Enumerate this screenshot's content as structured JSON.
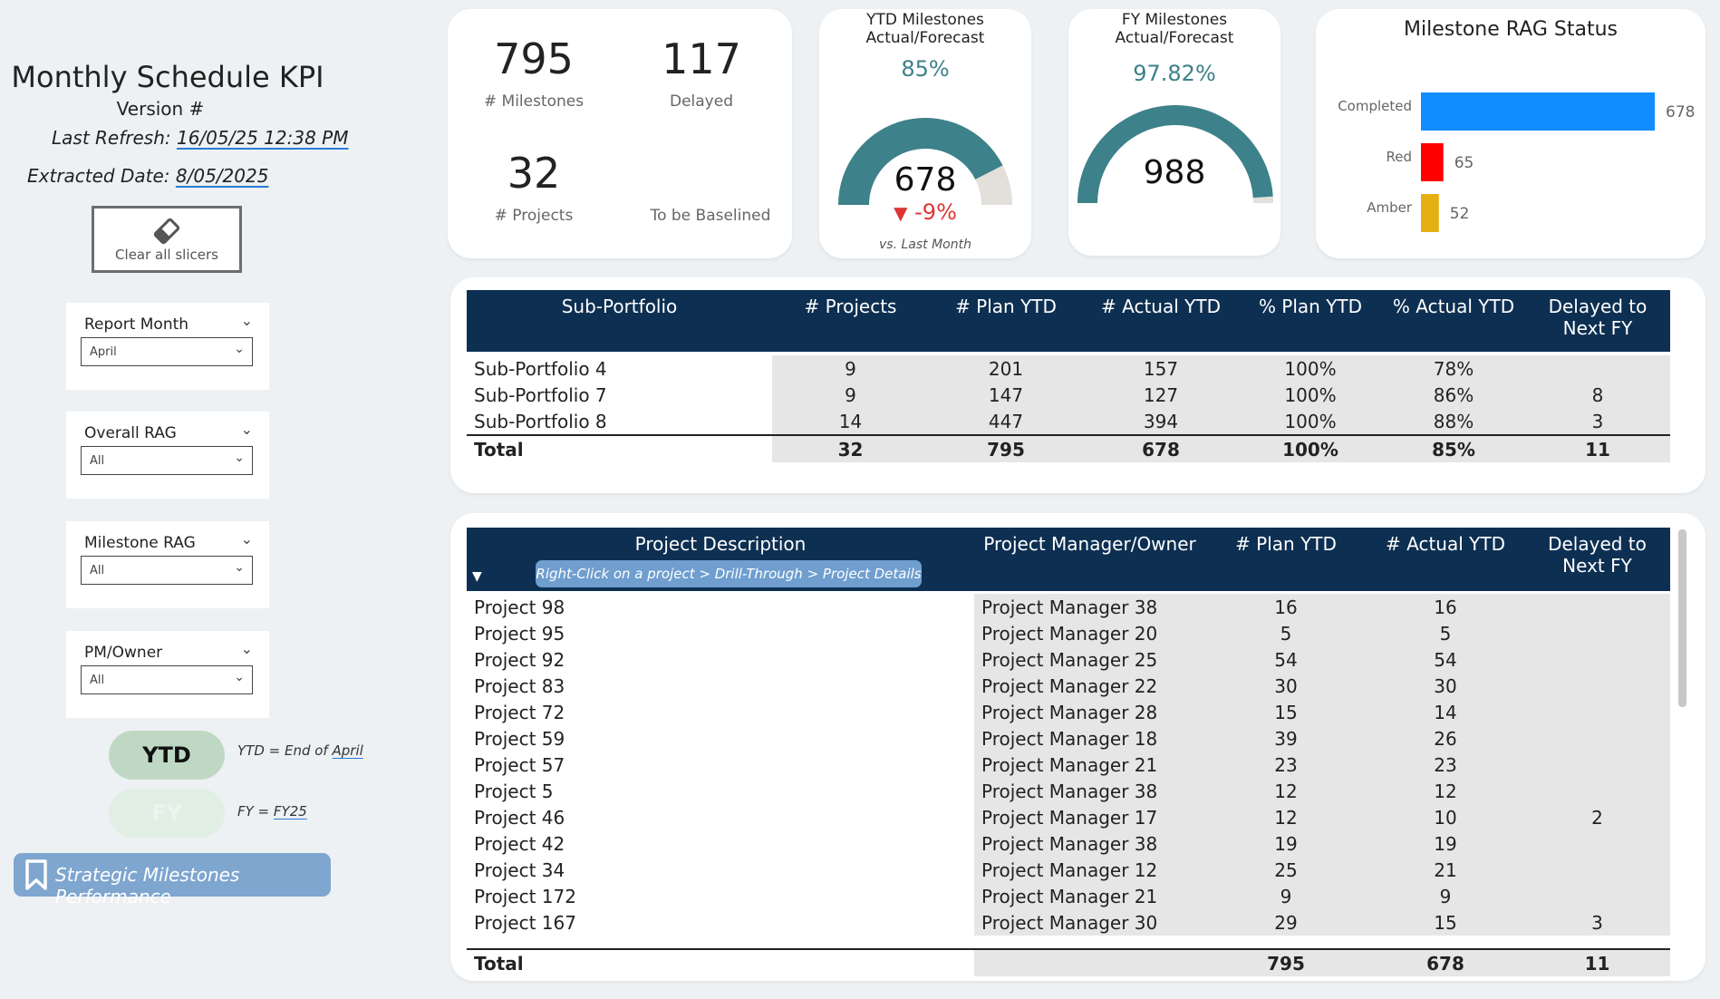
{
  "header": {
    "title": "Monthly Schedule KPI",
    "version": "Version #",
    "last_refresh_label": "Last Refresh:",
    "last_refresh_value": "16/05/25 12:38 PM",
    "extracted_label": "Extracted Date:",
    "extracted_value": "8/05/2025"
  },
  "clear_slicers": {
    "label": "Clear all slicers",
    "icon": "eraser-icon"
  },
  "slicers": [
    {
      "label": "Report Month",
      "value": "April"
    },
    {
      "label": "Overall RAG",
      "value": "All"
    },
    {
      "label": "Milestone RAG",
      "value": "All"
    },
    {
      "label": "PM/Owner",
      "value": "All"
    }
  ],
  "toggles": {
    "ytd": {
      "label": "YTD",
      "note_prefix": "YTD = End of",
      "note_value": "April"
    },
    "fy": {
      "label": "FY",
      "note_prefix": "FY =",
      "note_value": "FY25"
    }
  },
  "bookmark": {
    "label": "Strategic Milestones Performance",
    "icon": "bookmark-icon"
  },
  "kpis": {
    "milestones": {
      "value": "795",
      "label": "# Milestones"
    },
    "delayed": {
      "value": "117",
      "label": "Delayed"
    },
    "projects": {
      "value": "32",
      "label": "# Projects"
    },
    "to_be_baselined": {
      "value": "",
      "label": "To be Baselined"
    }
  },
  "ytd_gauge": {
    "title_line1": "YTD Milestones",
    "title_line2": "Actual/Forecast",
    "percent": "85%",
    "value": "678",
    "fraction": 0.85,
    "change": "-9%",
    "change_note": "vs. Last Month",
    "color": "#3d818a"
  },
  "fy_gauge": {
    "title_line1": "FY Milestones",
    "title_line2": "Actual/Forecast",
    "percent": "97.82%",
    "value": "988",
    "fraction": 0.9782,
    "color": "#3d818a"
  },
  "chart_data": {
    "type": "bar",
    "title": "Milestone RAG Status",
    "categories": [
      "Completed",
      "Red",
      "Amber"
    ],
    "values": [
      678,
      65,
      52
    ],
    "colors": [
      "#118dff",
      "#ff0000",
      "#e6b015"
    ],
    "orientation": "horizontal",
    "xlim": [
      0,
      678
    ]
  },
  "portfolio_table": {
    "headers": [
      "Sub-Portfolio",
      "# Projects",
      "# Plan YTD",
      "# Actual YTD",
      "% Plan YTD",
      "% Actual YTD",
      "Delayed to Next FY"
    ],
    "rows": [
      [
        "Sub-Portfolio 4",
        "9",
        "201",
        "157",
        "100%",
        "78%",
        ""
      ],
      [
        "Sub-Portfolio 7",
        "9",
        "147",
        "127",
        "100%",
        "86%",
        "8"
      ],
      [
        "Sub-Portfolio 8",
        "14",
        "447",
        "394",
        "100%",
        "88%",
        "3"
      ]
    ],
    "total": [
      "Total",
      "32",
      "795",
      "678",
      "100%",
      "85%",
      "11"
    ]
  },
  "project_table": {
    "headers": [
      "Project Description",
      "Project Manager/Owner",
      "# Plan YTD",
      "# Actual YTD",
      "Delayed to Next FY"
    ],
    "hint": "Right-Click on a project > Drill-Through > Project Details",
    "rows": [
      [
        "Project 98",
        "Project Manager 38",
        "16",
        "16",
        ""
      ],
      [
        "Project 95",
        "Project Manager 20",
        "5",
        "5",
        ""
      ],
      [
        "Project 92",
        "Project Manager 25",
        "54",
        "54",
        ""
      ],
      [
        "Project 83",
        "Project Manager 22",
        "30",
        "30",
        ""
      ],
      [
        "Project 72",
        "Project Manager 28",
        "15",
        "14",
        ""
      ],
      [
        "Project 59",
        "Project Manager 18",
        "39",
        "26",
        ""
      ],
      [
        "Project 57",
        "Project Manager 21",
        "23",
        "23",
        ""
      ],
      [
        "Project 5",
        "Project Manager 38",
        "12",
        "12",
        ""
      ],
      [
        "Project 46",
        "Project Manager 17",
        "12",
        "10",
        "2"
      ],
      [
        "Project 42",
        "Project Manager 38",
        "19",
        "19",
        ""
      ],
      [
        "Project 34",
        "Project Manager 12",
        "25",
        "21",
        ""
      ],
      [
        "Project 172",
        "Project Manager 21",
        "9",
        "9",
        ""
      ],
      [
        "Project 167",
        "Project Manager 30",
        "29",
        "15",
        "3"
      ]
    ],
    "total": [
      "Total",
      "",
      "795",
      "678",
      "11"
    ]
  }
}
